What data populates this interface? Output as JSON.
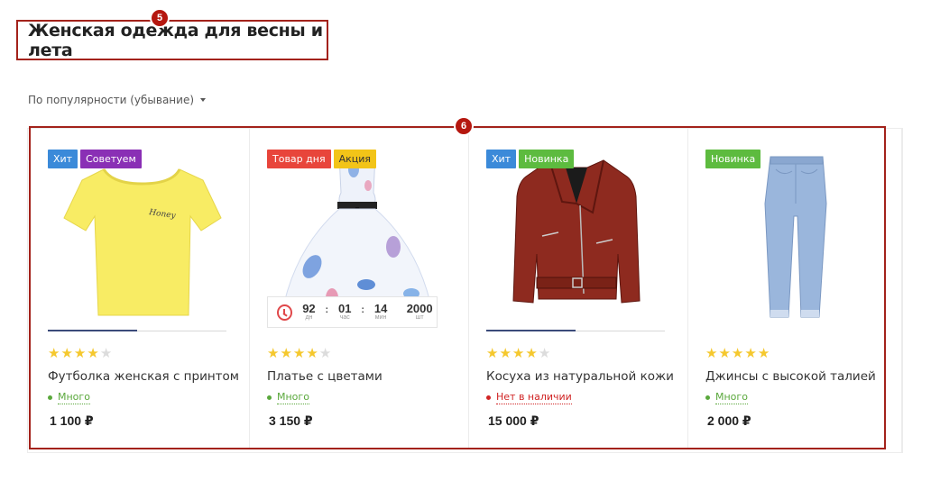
{
  "markers": {
    "title_marker": "5",
    "grid_marker": "6"
  },
  "page_title": "Женская одежда для весны и лета",
  "sort": {
    "label": "По популярности (убывание)"
  },
  "colors": {
    "accent_red": "#a3221b",
    "badge_hit": "#3b8ad9",
    "badge_recommend": "#8a2fb5",
    "badge_new": "#5dbb3f",
    "badge_deal": "#e8453b",
    "badge_promo": "#f2c418",
    "stock_ok": "#5aa83c",
    "stock_none": "#d02424"
  },
  "products": [
    {
      "badges": [
        {
          "label": "Хит",
          "kind": "hit"
        },
        {
          "label": "Советуем",
          "kind": "recommend"
        }
      ],
      "image_icon": "yellow-tshirt-icon",
      "slider_progress": 0.5,
      "rating": 4,
      "name": "Футболка женская с принтом",
      "stock": "Много",
      "in_stock": true,
      "price": "1 100 ₽"
    },
    {
      "badges": [
        {
          "label": "Товар дня",
          "kind": "deal"
        },
        {
          "label": "Акция",
          "kind": "promo"
        }
      ],
      "image_icon": "floral-dress-icon",
      "timer": {
        "days": "92",
        "days_label": "дн",
        "hours": "01",
        "hours_label": "час",
        "minutes": "14",
        "minutes_label": "мин",
        "qty": "2000",
        "qty_label": "шт"
      },
      "rating": 4,
      "name": "Платье с цветами",
      "stock": "Много",
      "in_stock": true,
      "price": "3 150 ₽"
    },
    {
      "badges": [
        {
          "label": "Хит",
          "kind": "hit"
        },
        {
          "label": "Новинка",
          "kind": "new"
        }
      ],
      "image_icon": "leather-jacket-icon",
      "slider_progress": 0.5,
      "rating": 4,
      "name": "Косуха из натуральной кожи",
      "stock": "Нет в наличии",
      "in_stock": false,
      "price": "15 000 ₽"
    },
    {
      "badges": [
        {
          "label": "Новинка",
          "kind": "new"
        }
      ],
      "image_icon": "jeans-icon",
      "rating": 5,
      "name": "Джинсы с высокой талией",
      "stock": "Много",
      "in_stock": true,
      "price": "2 000 ₽"
    }
  ]
}
